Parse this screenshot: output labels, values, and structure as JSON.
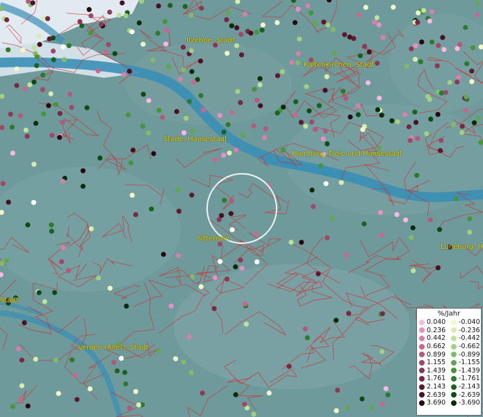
{
  "map": {
    "places": [
      {
        "id": "itzehoe",
        "label": "Itzehoe, Stadt"
      },
      {
        "id": "kaltenkirchen",
        "label": "Kaltenkirchen, Stadt"
      },
      {
        "id": "stade",
        "label": "Stade, Hansestadt"
      },
      {
        "id": "hamburg",
        "label": "Hamburg, Freie und Hansestadt"
      },
      {
        "id": "sittensen",
        "label": "Sittensen"
      },
      {
        "id": "lueneburg",
        "label": "Lüneburg, Hansestadt"
      },
      {
        "id": "stadt_west",
        "label": "Stadt"
      },
      {
        "id": "verden",
        "label": "Verden (Aller), Stadt"
      }
    ],
    "colors": {
      "land": "#6f9a9b",
      "water": "#3a8fb5",
      "boundary": "#d42a2a",
      "label": "#e8e000",
      "marker_circle": "#ffffff"
    }
  },
  "legend": {
    "title": "%/Jahr",
    "positive": [
      {
        "value": "0.040",
        "color": "#f7b8e4"
      },
      {
        "value": "0.236",
        "color": "#e890c4"
      },
      {
        "value": "0.442",
        "color": "#d880a8"
      },
      {
        "value": "0.662",
        "color": "#c86890"
      },
      {
        "value": "0.899",
        "color": "#b4587c"
      },
      {
        "value": "1.155",
        "color": "#a04868"
      },
      {
        "value": "1.439",
        "color": "#8c3856"
      },
      {
        "value": "1.761",
        "color": "#782840"
      },
      {
        "value": "2.143",
        "color": "#601a2e"
      },
      {
        "value": "2.639",
        "color": "#481020"
      },
      {
        "value": "3.690",
        "color": "#2a0810"
      }
    ],
    "negative": [
      {
        "value": "-0.040",
        "color": "#f2f7c8"
      },
      {
        "value": "-0.236",
        "color": "#d8ecb0"
      },
      {
        "value": "-0.442",
        "color": "#bfe29a"
      },
      {
        "value": "-0.662",
        "color": "#a0d080"
      },
      {
        "value": "-0.899",
        "color": "#80bc68"
      },
      {
        "value": "-1.155",
        "color": "#60a850"
      },
      {
        "value": "-1.439",
        "color": "#46943c"
      },
      {
        "value": "-1.761",
        "color": "#2e7a2c"
      },
      {
        "value": "-2.143",
        "color": "#1c621e"
      },
      {
        "value": "-2.639",
        "color": "#0e4a12"
      },
      {
        "value": "-3.690",
        "color": "#062c08"
      }
    ]
  }
}
